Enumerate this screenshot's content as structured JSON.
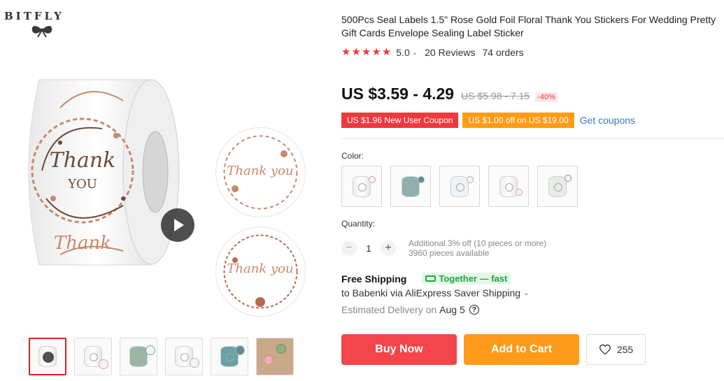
{
  "brand": {
    "name": "BITFLY",
    "icon": "bow-icon"
  },
  "gallery": {
    "main_image": "thank-you-sticker-roll",
    "sticker_text": [
      "Thank",
      "YOU",
      "Thank you",
      "Thank you",
      "Thank"
    ],
    "video_icon": "play-icon",
    "thumbnail_count": 6
  },
  "product": {
    "title": "500Pcs Seal Labels 1.5\" Rose Gold Foil Floral Thank You Stickers For Wedding Pretty Gift Cards Envelope Sealing Label Sticker",
    "rating": "5.0",
    "stars": 5,
    "reviews": "20 Reviews",
    "orders": "74 orders",
    "price": "US $3.59 - 4.29",
    "old_price": "US $5.98 - 7.15",
    "discount": "-40%"
  },
  "coupons": {
    "new_user": "US $1.96 New User Coupon",
    "store": "US $1.00 off on US $19.00",
    "get": "Get coupons"
  },
  "options": {
    "color_label": "Color:",
    "color_count": 5
  },
  "quantity": {
    "label": "Quantity:",
    "minus": "−",
    "plus": "+",
    "value": "1",
    "discount_note": "Additional 3% off (10 pieces or more)",
    "available": "3960 pieces available"
  },
  "shipping": {
    "title": "Free Shipping",
    "badge": "Together — fast",
    "to": "to Babenki via AliExpress Saver Shipping",
    "delivery_prefix": "Estimated Delivery on",
    "delivery_date": "Aug 5",
    "help": "?"
  },
  "actions": {
    "buy": "Buy Now",
    "cart": "Add to Cart",
    "wishlist_count": "255"
  },
  "colors": {
    "accent_red": "#f0383d",
    "accent_orange": "#ff9c12",
    "rose_gold": "#c8896b",
    "link": "#3a78c2",
    "green": "#1aa83b"
  }
}
